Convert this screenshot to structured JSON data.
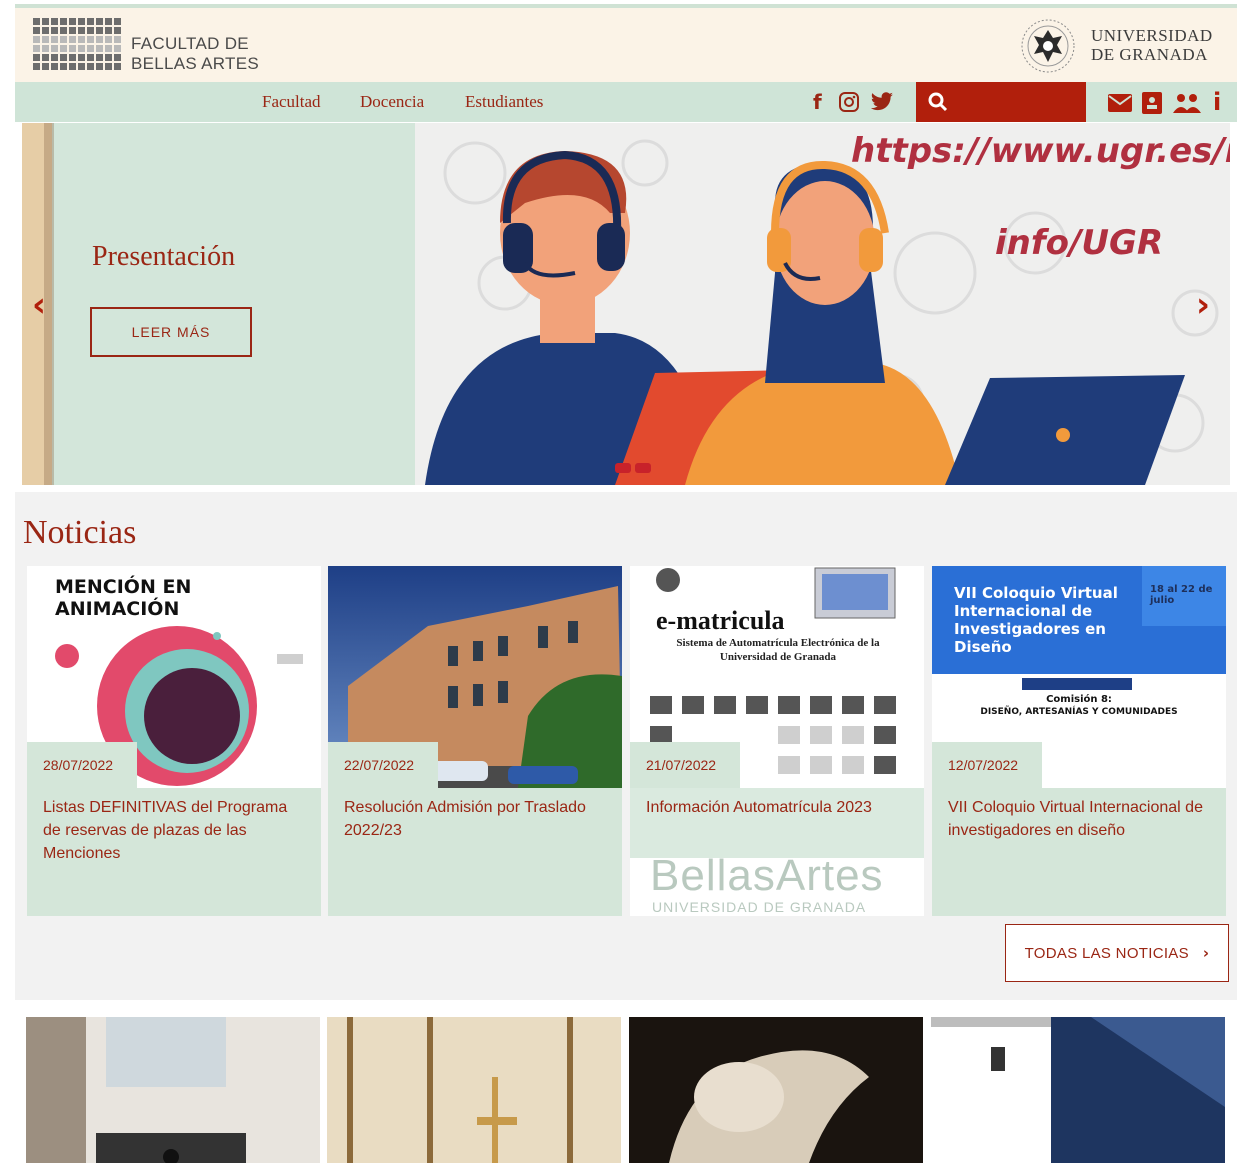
{
  "header": {
    "faculty_line1": "FACULTAD DE",
    "faculty_line2": "BELLAS ARTES",
    "university_line1": "UNIVERSIDAD",
    "university_line2": "DE GRANADA"
  },
  "nav": {
    "items": [
      "Facultad",
      "Docencia",
      "Estudiantes"
    ],
    "social": [
      "facebook-icon",
      "instagram-icon",
      "twitter-icon"
    ],
    "quick_links": [
      "mail-icon",
      "directory-icon",
      "users-icon",
      "info-icon"
    ]
  },
  "hero": {
    "title": "Presentación",
    "button": "LEER MÁS",
    "url_text": "https://www.ugr.es/inf",
    "info_text": "info/UGR"
  },
  "news": {
    "title": "Noticias",
    "all_button": "TODAS LAS NOTICIAS",
    "items": [
      {
        "date": "28/07/2022",
        "text": "Listas DEFINITIVAS del Programa de reservas de plazas de las Menciones",
        "img_caption": "MENCIÓN EN ANIMACIÓN"
      },
      {
        "date": "22/07/2022",
        "text": "Resolución Admisión por Traslado 2022/23"
      },
      {
        "date": "21/07/2022",
        "text": "Información Automatrícula 2023",
        "img_caption": "e-matricula",
        "img_sub": "Sistema de Automatrícula Electrónica de la Universidad de Granada",
        "img_footer": "BellasArtes",
        "img_footer2": "UNIVERSIDAD DE GRANADA"
      },
      {
        "date": "12/07/2022",
        "text": "VII Coloquio Virtual Internacional de investigadores en diseño",
        "img_caption": "VII Coloquio Virtual Internacional de Investigadores en Diseño",
        "img_dates": "18 al 22 de julio",
        "img_session": "Comisión 8:",
        "img_session_title": "DISEÑO, ARTESANÍAS Y COMUNIDADES"
      }
    ]
  },
  "colors": {
    "accent": "#9a2614",
    "red": "#b11f0c",
    "mint": "#d4e6d9",
    "cream": "#fbf3e7"
  }
}
